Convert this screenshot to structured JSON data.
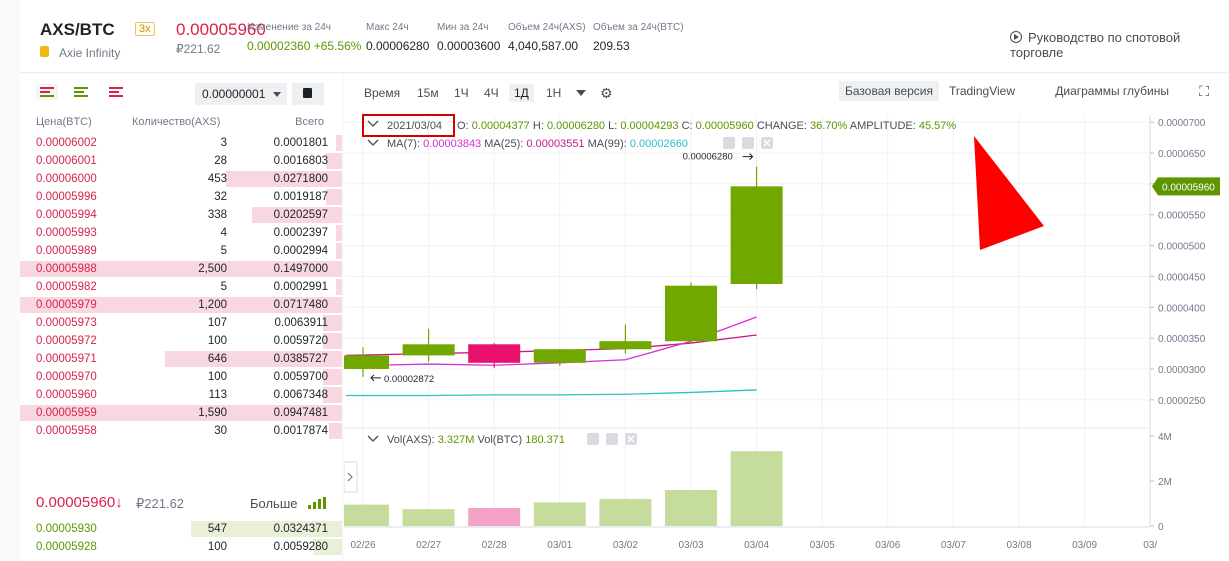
{
  "header": {
    "pair": "AXS/BTC",
    "leverage": "3x",
    "coin_name": "Axie Infinity",
    "last_price": "0.00005960",
    "last_price_rub": "₽221.62",
    "change_label": "Изменение за 24ч",
    "change_value": "0.00002360 +65.56%",
    "high_label": "Макс 24ч",
    "high_value": "0.00006280",
    "low_label": "Мин за 24ч",
    "low_value": "0.00003600",
    "vol_axs_label": "Объем 24ч(AXS)",
    "vol_axs_value": "4,040,587.00",
    "vol_btc_label": "Объем за 24ч(BTC)",
    "vol_btc_value": "209.53",
    "guide_link": "Руководство по спотовой торговле"
  },
  "orderbook": {
    "precision": "0.00000001",
    "col_price": "Цена(BTC)",
    "col_qty": "Количество(AXS)",
    "col_total": "Всего",
    "asks": [
      {
        "price": "0.00006002",
        "qty": "3",
        "total": "0.0001801",
        "depth": 0.02
      },
      {
        "price": "0.00006001",
        "qty": "28",
        "total": "0.0016803",
        "depth": 0.05
      },
      {
        "price": "0.00006000",
        "qty": "453",
        "total": "0.0271800",
        "depth": 0.36
      },
      {
        "price": "0.00005996",
        "qty": "32",
        "total": "0.0019187",
        "depth": 0.05
      },
      {
        "price": "0.00005994",
        "qty": "338",
        "total": "0.0202597",
        "depth": 0.28
      },
      {
        "price": "0.00005993",
        "qty": "4",
        "total": "0.0002397",
        "depth": 0.02
      },
      {
        "price": "0.00005989",
        "qty": "5",
        "total": "0.0002994",
        "depth": 0.02
      },
      {
        "price": "0.00005988",
        "qty": "2,500",
        "total": "0.1497000",
        "depth": 1.0
      },
      {
        "price": "0.00005982",
        "qty": "5",
        "total": "0.0002991",
        "depth": 0.02
      },
      {
        "price": "0.00005979",
        "qty": "1,200",
        "total": "0.0717480",
        "depth": 1.0
      },
      {
        "price": "0.00005973",
        "qty": "107",
        "total": "0.0063911",
        "depth": 0.06
      },
      {
        "price": "0.00005972",
        "qty": "100",
        "total": "0.0059720",
        "depth": 0.06
      },
      {
        "price": "0.00005971",
        "qty": "646",
        "total": "0.0385727",
        "depth": 0.55
      },
      {
        "price": "0.00005970",
        "qty": "100",
        "total": "0.0059700",
        "depth": 0.06
      },
      {
        "price": "0.00005960",
        "qty": "113",
        "total": "0.0067348",
        "depth": 0.06
      },
      {
        "price": "0.00005959",
        "qty": "1,590",
        "total": "0.0947481",
        "depth": 1.0
      },
      {
        "price": "0.00005958",
        "qty": "30",
        "total": "0.0017874",
        "depth": 0.04
      }
    ],
    "mid_price": "0.00005960",
    "mid_arrow": "↓",
    "mid_rub": "₽221.62",
    "more_label": "Больше",
    "bids": [
      {
        "price": "0.00005930",
        "qty": "547",
        "total": "0.0324371",
        "depth": 0.47
      },
      {
        "price": "0.00005928",
        "qty": "100",
        "total": "0.0059280",
        "depth": 0.09
      }
    ]
  },
  "chart_toolbar": {
    "intervals": [
      "Время",
      "15м",
      "1Ч",
      "4Ч",
      "1Д",
      "1Н"
    ],
    "active_interval": "1Д",
    "versions": [
      "Базовая версия",
      "TradingView",
      "Диаграммы глубины"
    ],
    "active_version": "Базовая версия"
  },
  "ohlc_legend": {
    "date": "2021/03/04",
    "open_label": "O:",
    "open": "0.00004377",
    "high_label": "H:",
    "high": "0.00006280",
    "low_label": "L:",
    "low": "0.00004293",
    "close_label": "C:",
    "close": "0.00005960",
    "change_label": "CHANGE:",
    "change": "36.70%",
    "amp_label": "AMPLITUDE:",
    "amp": "45.57%"
  },
  "ma_legend": {
    "ma7_label": "MA(7):",
    "ma7": "0.00003843",
    "ma25_label": "MA(25):",
    "ma25": "0.00003551",
    "ma99_label": "MA(99):",
    "ma99": "0.00002660"
  },
  "vol_legend": {
    "axs_label": "Vol(AXS):",
    "axs": "3.327M",
    "btc_label": "Vol(BTC)",
    "btc": "180.371"
  },
  "price_marker": "0.00005960",
  "high_marker": "0.00006280",
  "low_marker": "0.00002872",
  "colors": {
    "up": "#70a800",
    "down": "#e8116e",
    "ma7": "#d62fd6",
    "ma25": "#c81a8b",
    "ma99": "#2bbfc8",
    "annotation": "#d40000"
  },
  "chart_data": {
    "type": "candlestick",
    "x": [
      "02/26",
      "02/27",
      "02/28",
      "03/01",
      "03/02",
      "03/03",
      "03/04"
    ],
    "x_ticks": [
      "02/26",
      "02/27",
      "02/28",
      "03/01",
      "03/02",
      "03/03",
      "03/04",
      "03/05",
      "03/06",
      "03/07",
      "03/08",
      "03/09",
      "03/"
    ],
    "open": [
      3e-05,
      3.22e-05,
      3.4e-05,
      3.1e-05,
      3.32e-05,
      3.45e-05,
      4.377e-05
    ],
    "high": [
      3.35e-05,
      3.65e-05,
      3.42e-05,
      3.32e-05,
      3.72e-05,
      4.4e-05,
      6.28e-05
    ],
    "low": [
      2.872e-05,
      3.12e-05,
      3.02e-05,
      3.05e-05,
      3.25e-05,
      3.42e-05,
      4.293e-05
    ],
    "close": [
      3.22e-05,
      3.4e-05,
      3.1e-05,
      3.32e-05,
      3.45e-05,
      4.35e-05,
      5.96e-05
    ],
    "ma7": [
      3.05e-05,
      3.08e-05,
      3.06e-05,
      3.1e-05,
      3.15e-05,
      3.45e-05,
      3.843e-05
    ],
    "ma25": [
      3.22e-05,
      3.25e-05,
      3.27e-05,
      3.3e-05,
      3.33e-05,
      3.42e-05,
      3.551e-05
    ],
    "ma99": [
      2.57e-05,
      2.57e-05,
      2.58e-05,
      2.58e-05,
      2.59e-05,
      2.62e-05,
      2.66e-05
    ],
    "volume": [
      0.95,
      0.75,
      0.8,
      1.05,
      1.2,
      1.6,
      3.327
    ],
    "price_ticks": [
      "0.0000700",
      "0.0000650",
      "0.0000600",
      "0.0000550",
      "0.0000500",
      "0.0000450",
      "0.0000400",
      "0.0000350",
      "0.0000300",
      "0.0000250"
    ],
    "volume_ticks": [
      "4M",
      "2M",
      "0"
    ],
    "ylim": [
      2.4e-05,
      7.1e-05
    ],
    "vol_ylim": [
      0,
      4
    ]
  }
}
